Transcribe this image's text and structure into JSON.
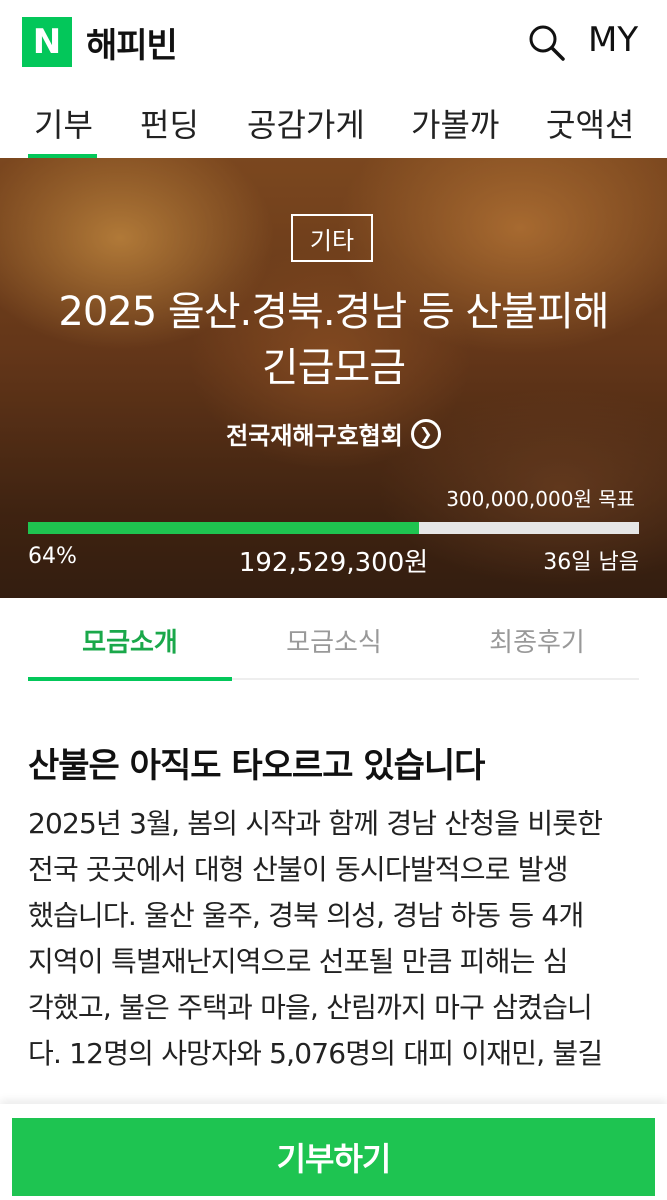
{
  "header": {
    "logo_letter": "N",
    "brand": "해피빈",
    "my_label": "MY"
  },
  "nav": {
    "items": [
      "기부",
      "펀딩",
      "공감가게",
      "가볼까",
      "굿액션"
    ],
    "active": "기부"
  },
  "hero": {
    "category": "기타",
    "title_line1": "2025 울산.경북.경남 등 산불피해",
    "title_line2": "긴급모금",
    "organization": "전국재해구호협회",
    "goal": "300,000,000원 목표",
    "progress_fraction": 0.64,
    "percent": "64%",
    "amount": "192,529,300원",
    "remaining": "36일 남음"
  },
  "tabs": {
    "items": [
      "모금소개",
      "모금소식",
      "최종후기"
    ],
    "active": "모금소개"
  },
  "article": {
    "heading": "산불은 아직도 타오르고 있습니다",
    "body": "2025년 3월, 봄의 시작과 함께 경남 산청을 비롯한\n전국 곳곳에서 대형 산불이 동시다발적으로 발생\n했습니다. 울산 울주, 경북 의성, 경남 하동 등 4개\n지역이 특별재난지역으로 선포될 만큼 피해는 심\n각했고, 불은 주택과 마을, 산림까지 마구 삼켰습니\n다. 12명의 사망자와 5,076명의 대피 이재민, 불길"
  },
  "donate": {
    "label": "기부하기"
  },
  "colors": {
    "brand_green": "#03c75a",
    "button_green": "#1ec451",
    "progress_track": "#e6e6e6"
  }
}
